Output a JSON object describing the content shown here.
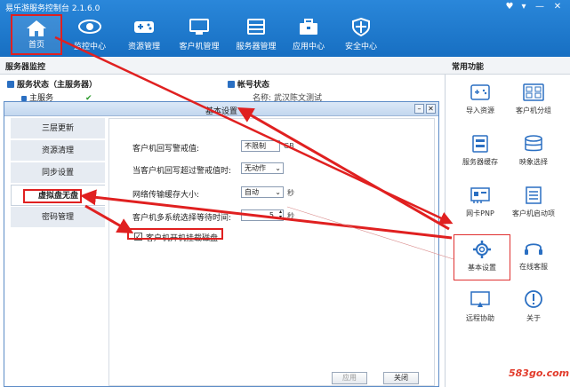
{
  "app": {
    "title": "易乐游服务控制台 2.1.6.0"
  },
  "nav": {
    "home": "首页",
    "monitor": "监控中心",
    "resources": "资源管理",
    "clients": "客户机管理",
    "servers": "服务器管理",
    "apps": "应用中心",
    "security": "安全中心"
  },
  "left": {
    "header": "服务器监控",
    "server_status": "服务状态（主服务器）",
    "main_service": "主服务",
    "account_status": "帐号状态",
    "name_label": "名称:",
    "name_value": "武汉陈文测试"
  },
  "right": {
    "header": "常用功能",
    "items": [
      "导入资源",
      "客户机分组",
      "服务器缓存",
      "映象选择",
      "网卡PNP",
      "客户机启动项",
      "基本设置",
      "在线客服",
      "远程协助",
      "关于"
    ]
  },
  "dialog": {
    "title": "基本设置",
    "tabs": [
      "三层更新",
      "资源清理",
      "同步设置",
      "虚拟盘无盘",
      "密码管理"
    ],
    "fields": {
      "write_threshold_label": "客户机回写警戒值:",
      "write_threshold_value": "不限制",
      "write_threshold_unit": "GB",
      "over_action_label": "当客户机回写超过警戒值时:",
      "over_action_value": "无动作",
      "buffer_label": "网络传输缓存大小:",
      "buffer_value": "自动",
      "buffer_unit": "秒",
      "timeout_label": "客户机多系统选择等待时间:",
      "timeout_value": "5",
      "timeout_unit": "秒",
      "checkbox_label": "客户机开机挂载磁盘"
    },
    "apply": "应用",
    "close": "关闭"
  },
  "watermark": "583go.com",
  "colors": {
    "accent": "#1b74c8",
    "highlight": "#e02020"
  }
}
